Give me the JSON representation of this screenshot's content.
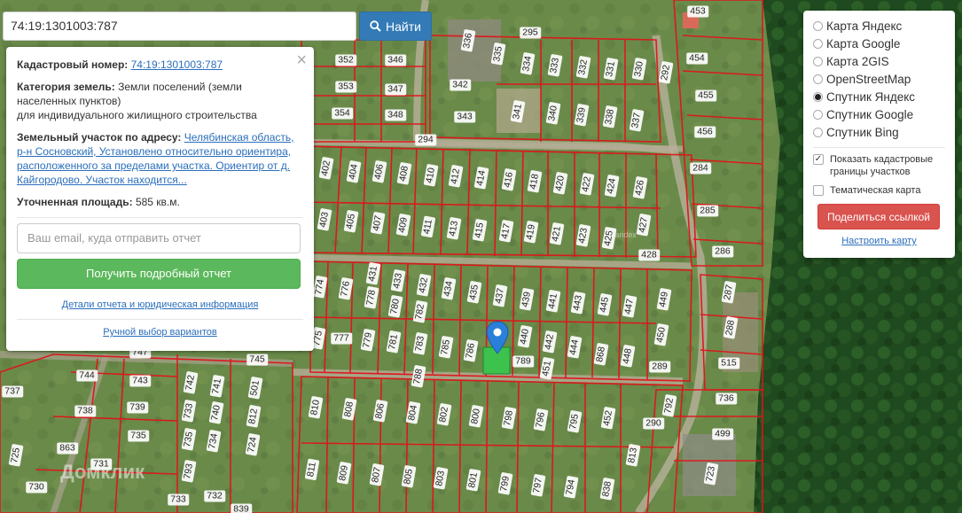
{
  "search": {
    "value": "74:19:1301003:787",
    "button_label": "Найти"
  },
  "info": {
    "cadastral_label": "Кадастровый номер:",
    "cadastral_number": "74:19:1301003:787",
    "category_label": "Категория земель:",
    "category_value": "Земли поселений (земли населенных пунктов)",
    "category_use": "для индивидуального жилищного строительства",
    "address_label": "Земельный участок по адресу:",
    "address_value": "Челябинская область, р-н Сосновский, Установлено относительно ориентира, расположенного за пределами участка. Ориентир от д. Кайгородово. Участок находится...",
    "area_label": "Уточненная площадь:",
    "area_value": "585 кв.м.",
    "email_placeholder": "Ваш email, куда отправить отчет",
    "report_button": "Получить подробный отчет",
    "details_link": "Детали отчета и юридическая информация",
    "manual_link": "Ручной выбор вариантов",
    "close": "×"
  },
  "layers": {
    "options": [
      {
        "label": "Карта Яндекс",
        "selected": false
      },
      {
        "label": "Карта Google",
        "selected": false
      },
      {
        "label": "Карта 2GIS",
        "selected": false
      },
      {
        "label": "OpenStreetMap",
        "selected": false
      },
      {
        "label": "Спутник Яндекс",
        "selected": true
      },
      {
        "label": "Спутник Google",
        "selected": false
      },
      {
        "label": "Спутник Bing",
        "selected": false
      }
    ],
    "show_cadastral": "Показать кадастровые границы участков",
    "thematic": "Тематическая карта",
    "share_button": "Поделиться ссылкой",
    "configure_link": "Настроить карту"
  },
  "watermark": "Домклик",
  "map_watermark": "Yandex",
  "plots": [
    {
      "n": "453"
    },
    {
      "n": "295"
    },
    {
      "n": "336"
    },
    {
      "n": "335"
    },
    {
      "n": "334"
    },
    {
      "n": "333"
    },
    {
      "n": "332"
    },
    {
      "n": "331"
    },
    {
      "n": "330"
    },
    {
      "n": "352"
    },
    {
      "n": "346"
    },
    {
      "n": "454"
    },
    {
      "n": "292"
    },
    {
      "n": "342"
    },
    {
      "n": "353"
    },
    {
      "n": "347"
    },
    {
      "n": "455"
    },
    {
      "n": "354"
    },
    {
      "n": "348"
    },
    {
      "n": "343"
    },
    {
      "n": "341"
    },
    {
      "n": "340"
    },
    {
      "n": "339"
    },
    {
      "n": "338"
    },
    {
      "n": "337"
    },
    {
      "n": "456"
    },
    {
      "n": "294"
    },
    {
      "n": "284"
    },
    {
      "n": "402"
    },
    {
      "n": "404"
    },
    {
      "n": "406"
    },
    {
      "n": "408"
    },
    {
      "n": "410"
    },
    {
      "n": "412"
    },
    {
      "n": "414"
    },
    {
      "n": "416"
    },
    {
      "n": "418"
    },
    {
      "n": "420"
    },
    {
      "n": "422"
    },
    {
      "n": "424"
    },
    {
      "n": "426"
    },
    {
      "n": "285"
    },
    {
      "n": "403"
    },
    {
      "n": "405"
    },
    {
      "n": "407"
    },
    {
      "n": "409"
    },
    {
      "n": "411"
    },
    {
      "n": "413"
    },
    {
      "n": "415"
    },
    {
      "n": "417"
    },
    {
      "n": "419"
    },
    {
      "n": "421"
    },
    {
      "n": "423"
    },
    {
      "n": "425"
    },
    {
      "n": "427"
    },
    {
      "n": "428"
    },
    {
      "n": "286"
    },
    {
      "n": "774"
    },
    {
      "n": "776"
    },
    {
      "n": "778"
    },
    {
      "n": "780"
    },
    {
      "n": "782"
    },
    {
      "n": "431"
    },
    {
      "n": "433"
    },
    {
      "n": "432"
    },
    {
      "n": "434"
    },
    {
      "n": "435"
    },
    {
      "n": "437"
    },
    {
      "n": "439"
    },
    {
      "n": "441"
    },
    {
      "n": "443"
    },
    {
      "n": "445"
    },
    {
      "n": "447"
    },
    {
      "n": "449"
    },
    {
      "n": "287"
    },
    {
      "n": "775"
    },
    {
      "n": "777"
    },
    {
      "n": "779"
    },
    {
      "n": "781"
    },
    {
      "n": "783"
    },
    {
      "n": "785"
    },
    {
      "n": "786"
    },
    {
      "n": "440"
    },
    {
      "n": "442"
    },
    {
      "n": "444"
    },
    {
      "n": "868"
    },
    {
      "n": "448"
    },
    {
      "n": "450"
    },
    {
      "n": "288"
    },
    {
      "n": "747"
    },
    {
      "n": "745"
    },
    {
      "n": "744"
    },
    {
      "n": "743"
    },
    {
      "n": "742"
    },
    {
      "n": "741"
    },
    {
      "n": "501"
    },
    {
      "n": "788"
    },
    {
      "n": "789"
    },
    {
      "n": "451"
    },
    {
      "n": "289"
    },
    {
      "n": "515"
    },
    {
      "n": "737"
    },
    {
      "n": "738"
    },
    {
      "n": "739"
    },
    {
      "n": "733"
    },
    {
      "n": "740"
    },
    {
      "n": "812"
    },
    {
      "n": "810"
    },
    {
      "n": "808"
    },
    {
      "n": "806"
    },
    {
      "n": "804"
    },
    {
      "n": "802"
    },
    {
      "n": "800"
    },
    {
      "n": "798"
    },
    {
      "n": "796"
    },
    {
      "n": "795"
    },
    {
      "n": "452"
    },
    {
      "n": "792"
    },
    {
      "n": "290"
    },
    {
      "n": "736"
    },
    {
      "n": "735"
    },
    {
      "n": "735"
    },
    {
      "n": "734"
    },
    {
      "n": "724"
    },
    {
      "n": "863"
    },
    {
      "n": "499"
    },
    {
      "n": "725"
    },
    {
      "n": "731"
    },
    {
      "n": "793"
    },
    {
      "n": "813"
    },
    {
      "n": "811"
    },
    {
      "n": "809"
    },
    {
      "n": "807"
    },
    {
      "n": "805"
    },
    {
      "n": "803"
    },
    {
      "n": "801"
    },
    {
      "n": "799"
    },
    {
      "n": "797"
    },
    {
      "n": "794"
    },
    {
      "n": "838"
    },
    {
      "n": "723"
    },
    {
      "n": "730"
    },
    {
      "n": "733"
    },
    {
      "n": "732"
    },
    {
      "n": "839"
    }
  ]
}
